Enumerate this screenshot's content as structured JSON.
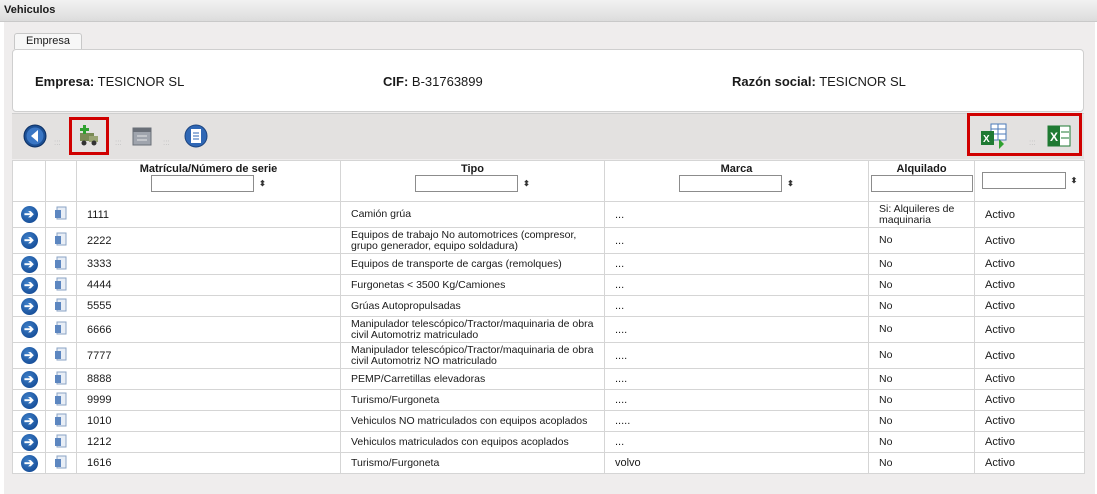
{
  "window": {
    "title": "Vehiculos"
  },
  "tabs": [
    {
      "label": "Empresa"
    }
  ],
  "company": {
    "empresa_label": "Empresa:",
    "empresa_value": "TESICNOR SL",
    "cif_label": "CIF:",
    "cif_value": "B-31763899",
    "razon_label": "Razón social:",
    "razon_value": "TESICNOR SL"
  },
  "toolbar": {
    "icons": [
      "back-icon",
      "add-vehicle-icon",
      "calendar-icon",
      "document-list-icon",
      "export-excel-add-icon",
      "excel-icon"
    ],
    "highlight_color": "#d00000"
  },
  "table": {
    "columns": [
      "Matrícula/Número de serie",
      "Tipo",
      "Marca",
      "Alquilado",
      ""
    ],
    "filter_sort_glyph": "⬍",
    "rows": [
      {
        "matricula": "1111",
        "tipo": "Camión grúa",
        "marca": "...",
        "alquilado": "Si: Alquileres de maquinaria",
        "estado": "Activo"
      },
      {
        "matricula": "2222",
        "tipo": "Equipos de trabajo No automotrices (compresor, grupo generador, equipo soldadura)",
        "marca": "...",
        "alquilado": "No",
        "estado": "Activo"
      },
      {
        "matricula": "3333",
        "tipo": "Equipos de transporte de cargas (remolques)",
        "marca": "...",
        "alquilado": "No",
        "estado": "Activo"
      },
      {
        "matricula": "4444",
        "tipo": "Furgonetas < 3500 Kg/Camiones",
        "marca": "...",
        "alquilado": "No",
        "estado": "Activo"
      },
      {
        "matricula": "5555",
        "tipo": "Grúas Autopropulsadas",
        "marca": "...",
        "alquilado": "No",
        "estado": "Activo"
      },
      {
        "matricula": "6666",
        "tipo": "Manipulador telescópico/Tractor/maquinaria de obra civil Automotriz matriculado",
        "marca": "....",
        "alquilado": "No",
        "estado": "Activo"
      },
      {
        "matricula": "7777",
        "tipo": "Manipulador telescópico/Tractor/maquinaria de obra civil Automotriz NO matriculado",
        "marca": "....",
        "alquilado": "No",
        "estado": "Activo"
      },
      {
        "matricula": "8888",
        "tipo": "PEMP/Carretillas elevadoras",
        "marca": "....",
        "alquilado": "No",
        "estado": "Activo"
      },
      {
        "matricula": "9999",
        "tipo": "Turismo/Furgoneta",
        "marca": "....",
        "alquilado": "No",
        "estado": "Activo"
      },
      {
        "matricula": "1010",
        "tipo": "Vehiculos NO matriculados con equipos acoplados",
        "marca": ".....",
        "alquilado": "No",
        "estado": "Activo"
      },
      {
        "matricula": "1212",
        "tipo": "Vehiculos matriculados con equipos acoplados",
        "marca": "...",
        "alquilado": "No",
        "estado": "Activo"
      },
      {
        "matricula": "1616",
        "tipo": "Turismo/Furgoneta",
        "marca": "volvo",
        "alquilado": "No",
        "estado": "Activo"
      }
    ]
  }
}
